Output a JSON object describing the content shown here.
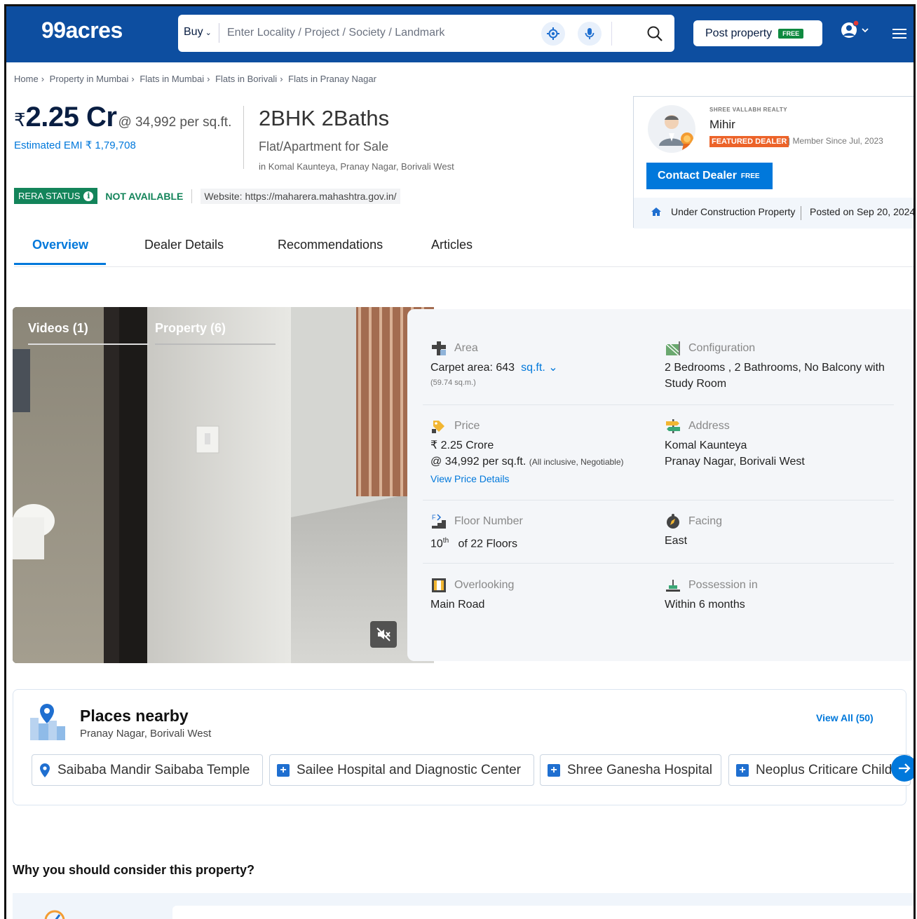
{
  "header": {
    "logo": "99acres",
    "buy_label": "Buy",
    "search_placeholder": "Enter Locality / Project / Society / Landmark",
    "post_label": "Post property",
    "post_free": "FREE"
  },
  "breadcrumb": [
    "Home",
    "Property in Mumbai",
    "Flats in Mumbai",
    "Flats in Borivali",
    "Flats in Pranay Nagar"
  ],
  "listing": {
    "rupee": "₹",
    "price": "2.25 Cr",
    "per_sqft": "@ 34,992 per sq.ft.",
    "emi": "Estimated EMI ₹ 1,79,708",
    "title": "2BHK 2Baths",
    "type": "Flat/Apartment for Sale",
    "location": "in Komal Kaunteya, Pranay Nagar, Borivali West",
    "rera_label": "RERA STATUS",
    "rera_value": "NOT AVAILABLE",
    "rera_website": "Website: https://maharera.mahashtra.gov.in/"
  },
  "dealer": {
    "firm": "SHREE VALLABH REALTY",
    "name": "Mihir",
    "badge": "FEATURED DEALER",
    "member_since": "| Member Since Jul, 2023",
    "contact_label": "Contact Dealer",
    "contact_free": "FREE",
    "status": "Under Construction Property",
    "posted": "Posted on Sep 20, 2024"
  },
  "tabs": [
    "Overview",
    "Dealer Details",
    "Recommendations",
    "Articles"
  ],
  "media": {
    "tab_videos": "Videos (1)",
    "tab_property": "Property (6)"
  },
  "details": {
    "area": {
      "label": "Area",
      "value": "Carpet area: 643",
      "unit": "sq.ft.",
      "sub": "(59.74 sq.m.)"
    },
    "config": {
      "label": "Configuration",
      "value": "2 Bedrooms , 2 Bathrooms, No Balcony with Study Room"
    },
    "price": {
      "label": "Price",
      "value": "₹ 2.25 Crore",
      "value2": "@ 34,992 per sq.ft.",
      "value2_note": "(All inclusive, Negotiable)",
      "link": "View Price Details"
    },
    "address": {
      "label": "Address",
      "line1": "Komal Kaunteya",
      "line2": "Pranay Nagar, Borivali West"
    },
    "floor": {
      "label": "Floor Number",
      "value_num": "10",
      "value_sup": "th",
      "value_rest": "of 22 Floors"
    },
    "facing": {
      "label": "Facing",
      "value": "East"
    },
    "overlooking": {
      "label": "Overlooking",
      "value": "Main Road"
    },
    "possession": {
      "label": "Possession in",
      "value": "Within 6 months"
    }
  },
  "places": {
    "title": "Places nearby",
    "subtitle": "Pranay Nagar, Borivali West",
    "view_all": "View All (50)",
    "chips": [
      "Saibaba Mandir Saibaba Temple",
      "Sailee Hospital and Diagnostic Center",
      "Shree Ganesha Hospital",
      "Neoplus Criticare Children"
    ]
  },
  "why_title": "Why you should consider this property?",
  "colors": {
    "brand": "#0d4ea0",
    "accent": "#0078db",
    "rera": "#13845a",
    "featured": "#ec6329"
  }
}
